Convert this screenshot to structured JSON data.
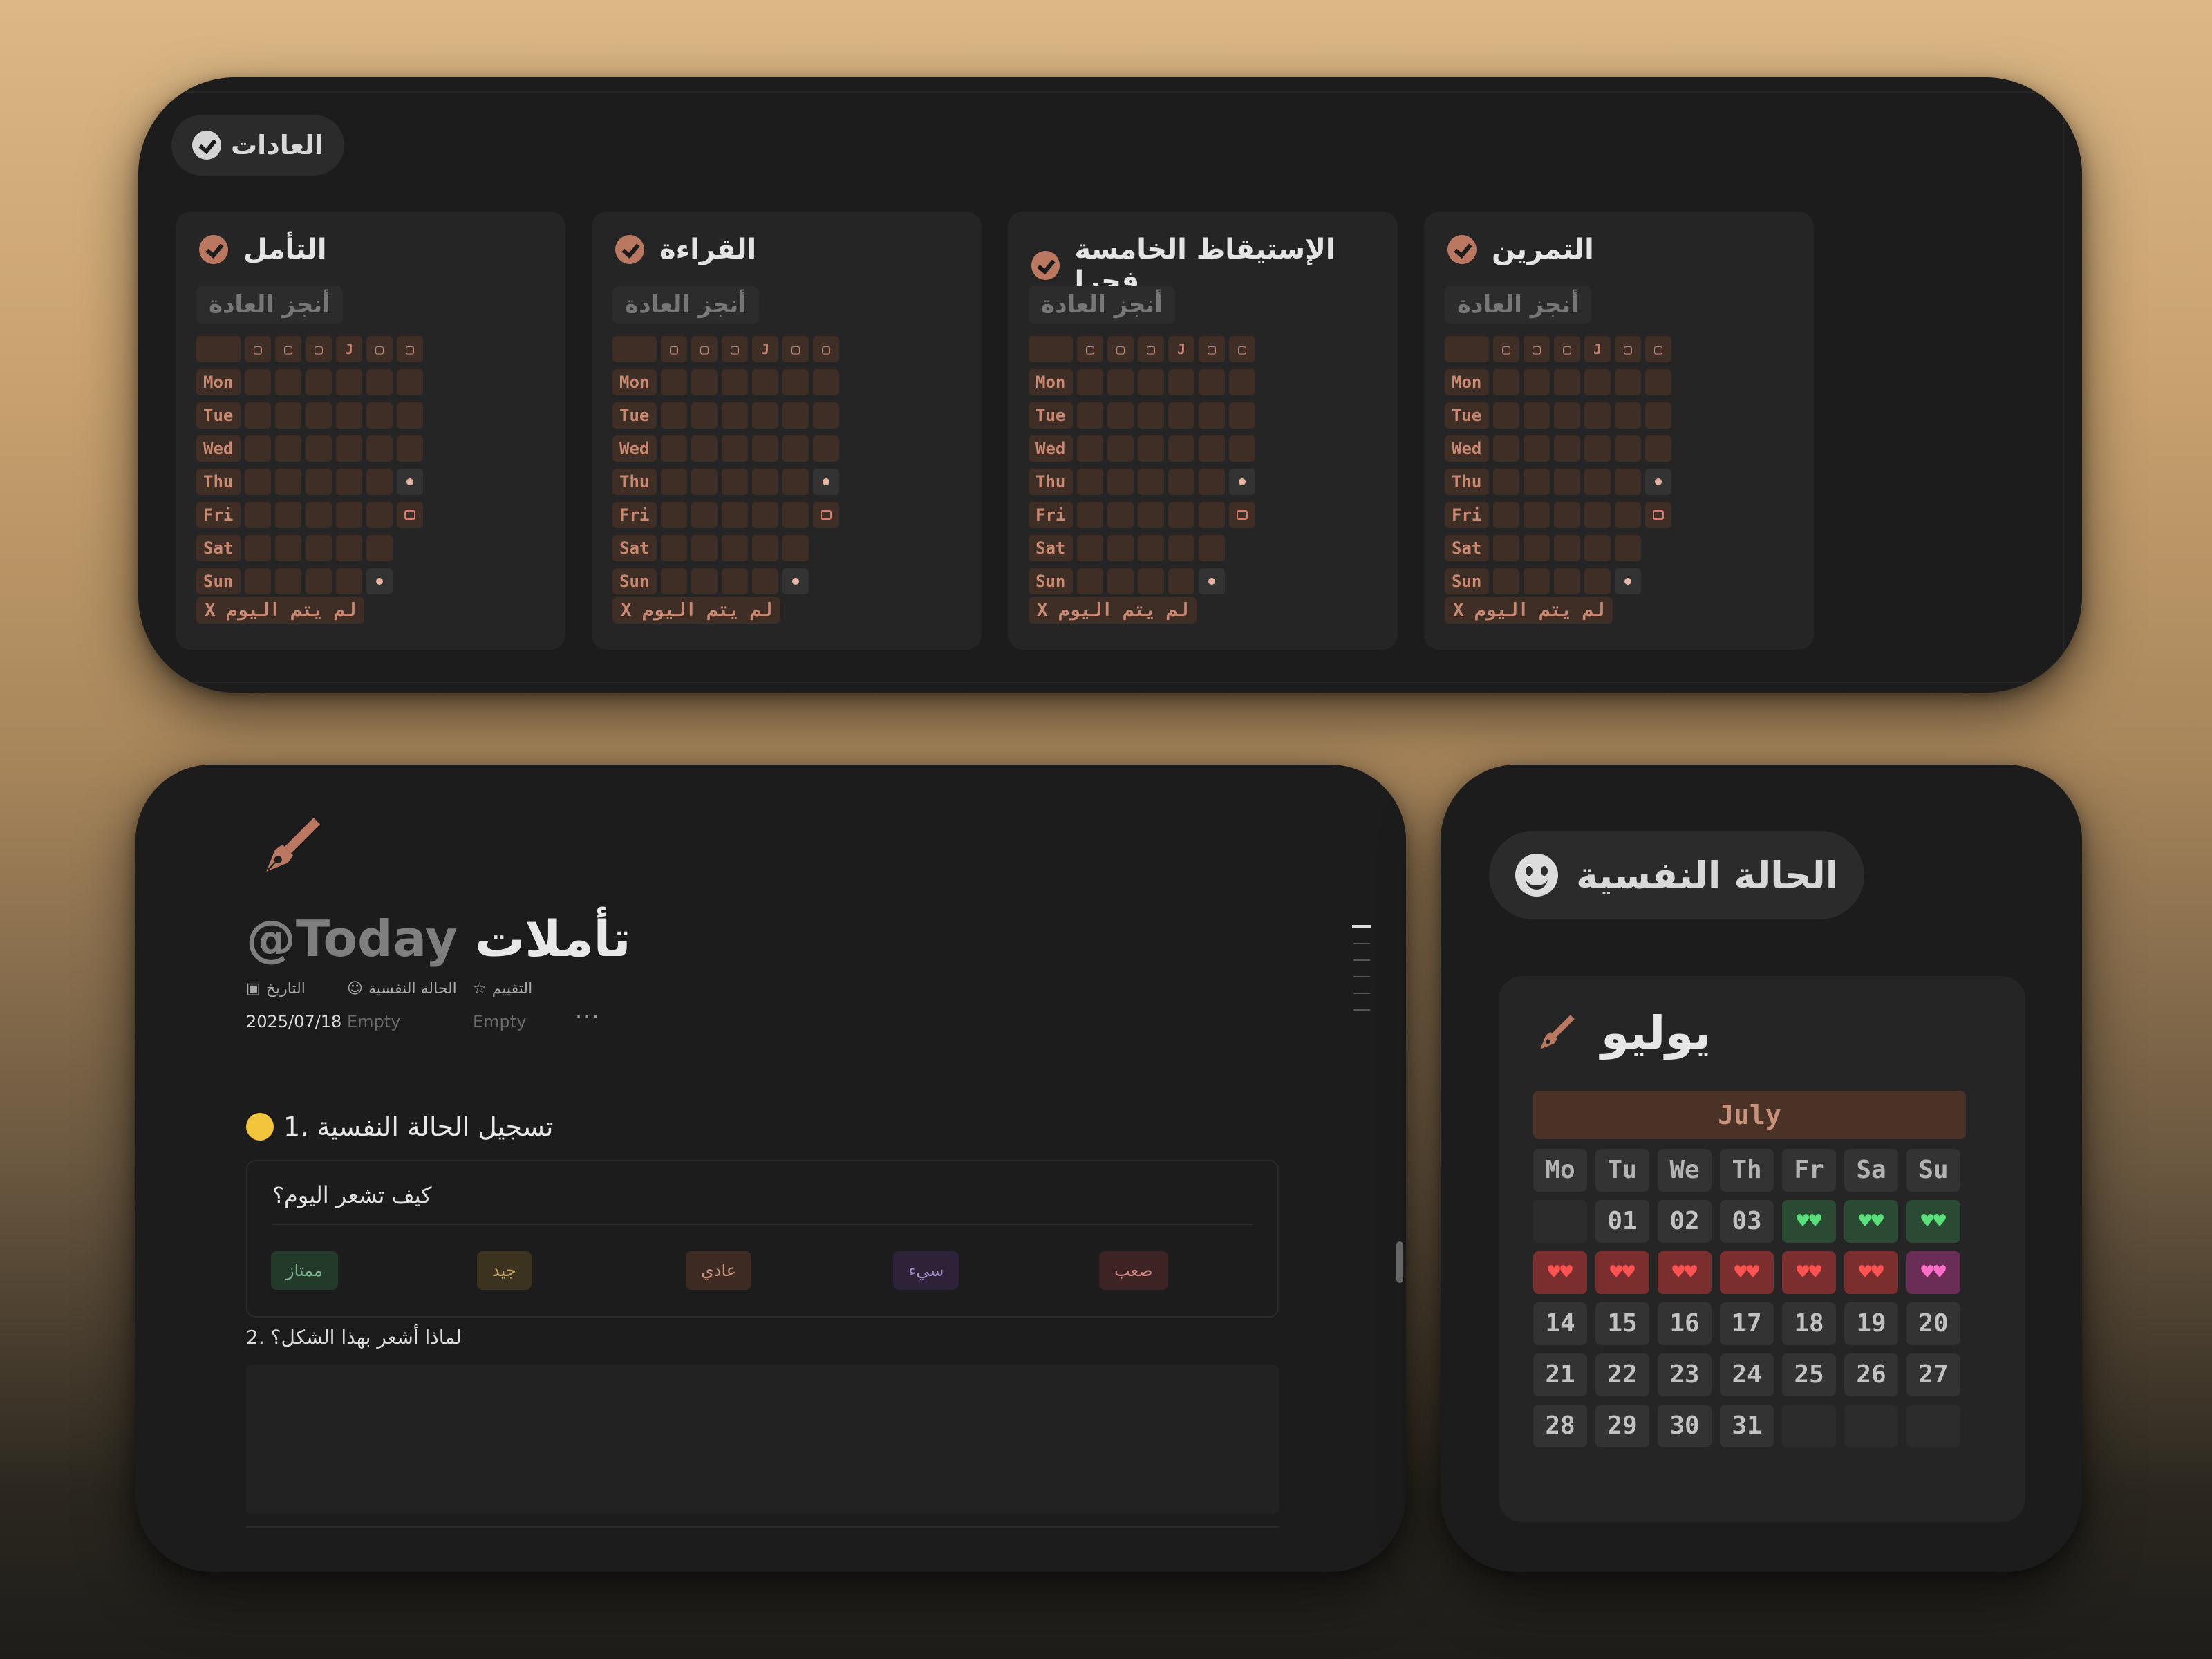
{
  "habits": {
    "header_label": "العادات",
    "complete_button": "أنجز العادة",
    "not_done_label": "X لم يتم اليوم",
    "header_cells": [
      "▢",
      "▢",
      "▢",
      "J",
      "▢",
      "▢"
    ],
    "day_labels": [
      "Mon",
      "Tue",
      "Wed",
      "Thu",
      "Fri",
      "Sat",
      "Sun"
    ],
    "cards": [
      {
        "title": "التأمل"
      },
      {
        "title": "القراءة"
      },
      {
        "title": "الإستيقاظ الخامسة فجرا"
      },
      {
        "title": "التمرين"
      }
    ]
  },
  "journal": {
    "title_mention": "@Today",
    "title_text": "تأملات",
    "properties": [
      {
        "icon": "calendar-icon",
        "label": "التاريخ",
        "value": "2025/07/18"
      },
      {
        "icon": "mood-icon",
        "label": "الحالة النفسية",
        "value": "Empty"
      },
      {
        "icon": "star-icon",
        "label": "التقييم",
        "value": "Empty"
      }
    ],
    "more": "···",
    "section1": "1. تسجيل الحالة النفسية",
    "question": "كيف تشعر اليوم؟",
    "moods": [
      {
        "label": "ممتاز",
        "bg": "#233a2b",
        "fg": "#7fb58f"
      },
      {
        "label": "جيد",
        "bg": "#3b3220",
        "fg": "#c7a66a"
      },
      {
        "label": "عادي",
        "bg": "#3d2a22",
        "fg": "#c9957f"
      },
      {
        "label": "سيء",
        "bg": "#2d2238",
        "fg": "#a48fc8"
      },
      {
        "label": "صعب",
        "bg": "#3d2323",
        "fg": "#d08a85"
      }
    ],
    "section2": "2. لماذا أشعر بهذا الشكل؟"
  },
  "mood_panel": {
    "chip_label": "الحالة النفسية",
    "calendar_title": "يوليو",
    "month_label": "July",
    "weekdays": [
      "Mo",
      "Tu",
      "We",
      "Th",
      "Fr",
      "Sa",
      "Su"
    ],
    "rows": [
      [
        {
          "t": "",
          "k": "blank"
        },
        {
          "t": "01",
          "k": "num"
        },
        {
          "t": "02",
          "k": "num"
        },
        {
          "t": "03",
          "k": "num"
        },
        {
          "t": "♥♥",
          "k": "green"
        },
        {
          "t": "♥♥",
          "k": "green"
        },
        {
          "t": "♥♥",
          "k": "green"
        }
      ],
      [
        {
          "t": "♥♥",
          "k": "red"
        },
        {
          "t": "♥♥",
          "k": "red"
        },
        {
          "t": "♥♥",
          "k": "red"
        },
        {
          "t": "♥♥",
          "k": "red"
        },
        {
          "t": "♥♥",
          "k": "red"
        },
        {
          "t": "♥♥",
          "k": "red"
        },
        {
          "t": "♥♥",
          "k": "pink"
        }
      ],
      [
        {
          "t": "14",
          "k": "num"
        },
        {
          "t": "15",
          "k": "num"
        },
        {
          "t": "16",
          "k": "num"
        },
        {
          "t": "17",
          "k": "num"
        },
        {
          "t": "18",
          "k": "num"
        },
        {
          "t": "19",
          "k": "num"
        },
        {
          "t": "20",
          "k": "num"
        }
      ],
      [
        {
          "t": "21",
          "k": "num"
        },
        {
          "t": "22",
          "k": "num"
        },
        {
          "t": "23",
          "k": "num"
        },
        {
          "t": "24",
          "k": "num"
        },
        {
          "t": "25",
          "k": "num"
        },
        {
          "t": "26",
          "k": "num"
        },
        {
          "t": "27",
          "k": "num"
        }
      ],
      [
        {
          "t": "28",
          "k": "num"
        },
        {
          "t": "29",
          "k": "num"
        },
        {
          "t": "30",
          "k": "num"
        },
        {
          "t": "31",
          "k": "num"
        },
        {
          "t": "",
          "k": "blank"
        },
        {
          "t": "",
          "k": "blank"
        },
        {
          "t": "",
          "k": "blank"
        }
      ]
    ]
  }
}
